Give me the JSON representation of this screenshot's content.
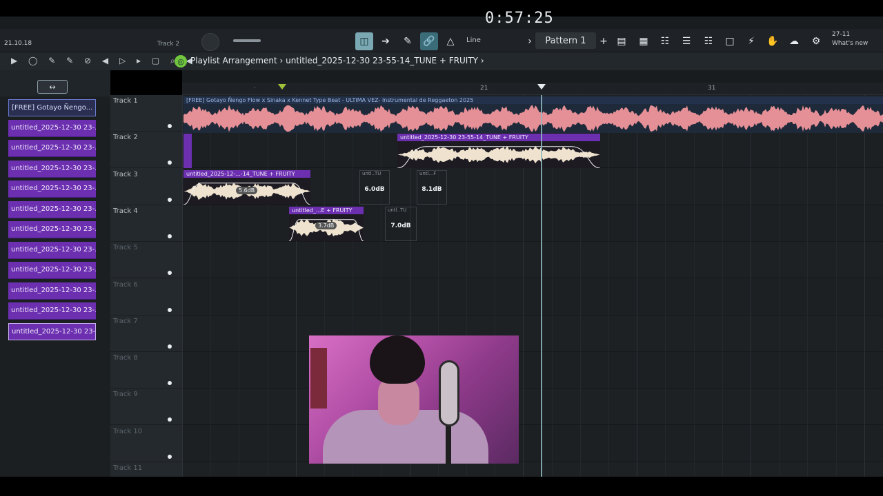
{
  "toolbar": {
    "time": "0:57:25",
    "clock": "21.10.18",
    "track_hint": "Track 2",
    "line_mode": "Line",
    "pattern": "Pattern 1",
    "whats_new_top": "27-11",
    "whats_new": "What's new"
  },
  "playlist": {
    "title": "Playlist",
    "breadcrumb": "Arrangement › untitled_2025-12-30 23-55-14_TUNE + FRUITY ›"
  },
  "patterns": [
    "[FREE] Gotayo Ñengo...",
    "untitled_2025-12-30 23-...",
    "untitled_2025-12-30 23-...",
    "untitled_2025-12-30 23-...",
    "untitled_2025-12-30 23-...",
    "untitled_2025-12-30 23-...",
    "untitled_2025-12-30 23-...",
    "untitled_2025-12-30 23-...",
    "untitled_2025-12-30 23-...",
    "untitled_2025-12-30 23-...",
    "untitled_2025-12-30 23-...",
    "untitled_2025-12-30 23-..."
  ],
  "tracks": [
    "Track 1",
    "Track 2",
    "Track 3",
    "Track 4",
    "Track 5",
    "Track 6",
    "Track 7",
    "Track 8",
    "Track 9",
    "Track 10",
    "Track 11"
  ],
  "ruler": {
    "bar_a": "21",
    "bar_b": "31"
  },
  "clips": {
    "track1": "[FREE] Gotayo Ñengo Flow x Sinaka x Kennet Type Beat - ULTIMA VEZ- Instrumental de Reggaeton 2025",
    "track2": "untitled_2025-12-30 23-55-14_TUNE + FRUITY",
    "track3": "untitled_2025-12-...-14_TUNE + FRUITY",
    "track4": "untitled_...E + FRUITY",
    "db_3a": "5.6dB",
    "db_4a": "3.7dB",
    "small_3a_head": "untl..TU",
    "small_3a_val": "6.0dB",
    "small_3b_head": "untl...F",
    "small_3b_val": "8.1dB",
    "small_4_head": "untl..TU",
    "small_4_val": "7.0dB"
  },
  "colors": {
    "accent": "#7aa9b3",
    "clip_purple": "#6b2fb0",
    "wave_pink": "#e58f96",
    "wave_cream": "#efe3cf",
    "playhead": "#8fb8bd"
  }
}
